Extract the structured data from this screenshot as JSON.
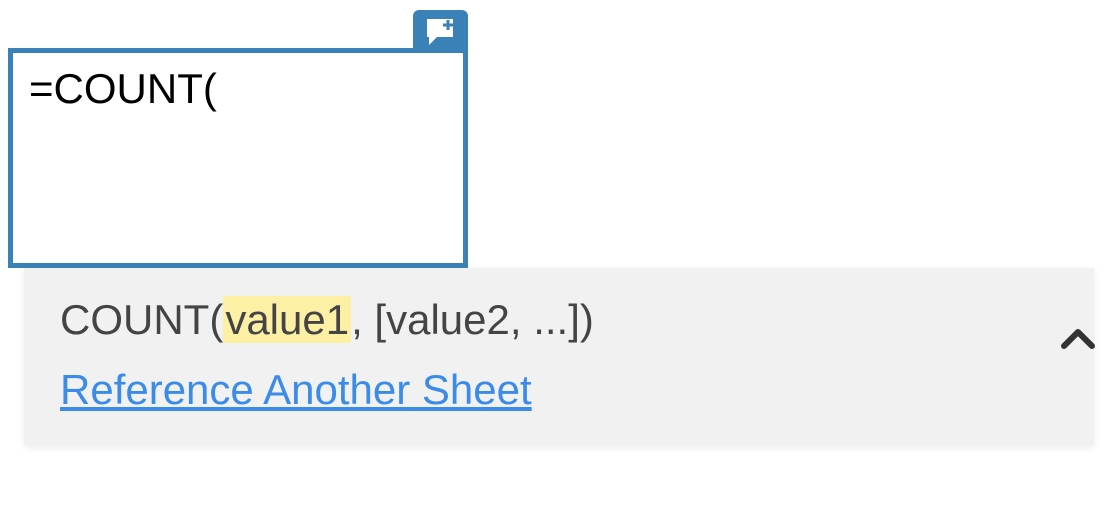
{
  "cell": {
    "input_value": "=COUNT("
  },
  "tooltip": {
    "func_name": "COUNT",
    "open_paren": "(",
    "arg_highlight": "value1",
    "arg_rest": ", [value2, ...])",
    "link_text": "Reference Another Sheet"
  },
  "icons": {
    "comment_add": "comment-add-icon",
    "caret_up": "caret-up-icon"
  }
}
